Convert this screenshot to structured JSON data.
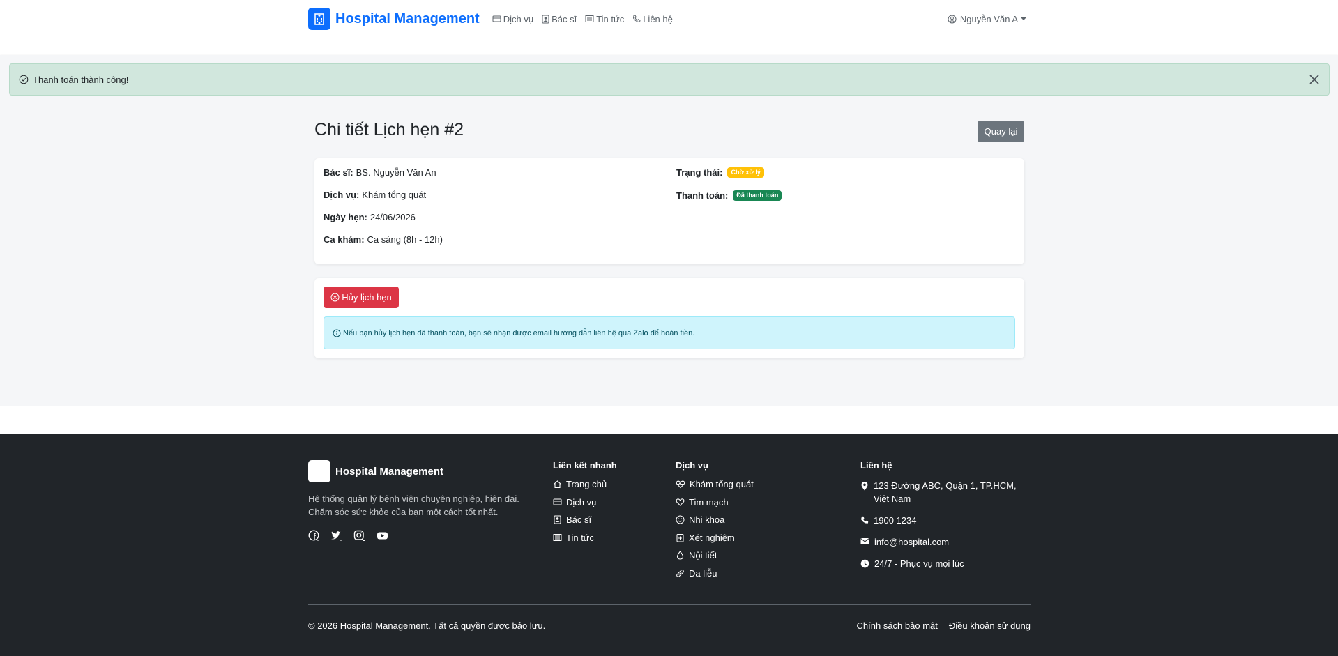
{
  "navbar": {
    "brand": "Hospital Management",
    "links": [
      "Dịch vụ",
      "Bác sĩ",
      "Tin tức",
      "Liên hệ"
    ],
    "user": "Nguyễn Văn A"
  },
  "alert": {
    "message": "Thanh toán thành công!"
  },
  "page": {
    "title": "Chi tiết Lịch hẹn #2",
    "back_label": "Quay lại"
  },
  "appointment": {
    "doctor_label": "Bác sĩ:",
    "doctor": "BS. Nguyễn Văn An",
    "service_label": "Dịch vụ:",
    "service": "Khám tổng quát",
    "date_label": "Ngày hẹn:",
    "date": "24/06/2026",
    "shift_label": "Ca khám:",
    "shift": "Ca sáng (8h - 12h)",
    "status_label": "Trạng thái:",
    "status": "Chờ xử lý",
    "payment_label": "Thanh toán:",
    "payment": "Đã thanh toán"
  },
  "actions": {
    "cancel_label": "Hủy lịch hẹn",
    "info_text": "Nếu bạn hủy lịch hẹn đã thanh toán, bạn sẽ nhận được email hướng dẫn liên hệ qua Zalo để hoàn tiền."
  },
  "footer": {
    "brand": "Hospital Management",
    "description": "Hệ thống quản lý bệnh viện chuyên nghiệp, hiện đại. Chăm sóc sức khỏe của bạn một cách tốt nhất.",
    "quick_links_title": "Liên kết nhanh",
    "quick_links": [
      "Trang chủ",
      "Dịch vụ",
      "Bác sĩ",
      "Tin tức"
    ],
    "services_title": "Dịch vụ",
    "services": [
      "Khám tổng quát",
      "Tim mạch",
      "Nhi khoa",
      "Xét nghiệm",
      "Nội tiết",
      "Da liễu"
    ],
    "contact_title": "Liên hệ",
    "contact": {
      "address": "123 Đường ABC, Quận 1, TP.HCM, Việt Nam",
      "phone": "1900 1234",
      "email": "info@hospital.com",
      "hours": "24/7 - Phục vụ mọi lúc"
    },
    "copyright": "© 2026 Hospital Management. Tất cả quyền được bảo lưu.",
    "privacy": "Chính sách bảo mật",
    "terms": "Điều khoản sử dụng"
  },
  "colors": {
    "primary": "#0d6efd",
    "success_bg": "#d1e7dd",
    "danger": "#dc3545",
    "secondary": "#6c757d",
    "warning": "#ffc107",
    "success": "#198754",
    "info_bg": "#cff4fc",
    "footer_bg": "#212529"
  }
}
